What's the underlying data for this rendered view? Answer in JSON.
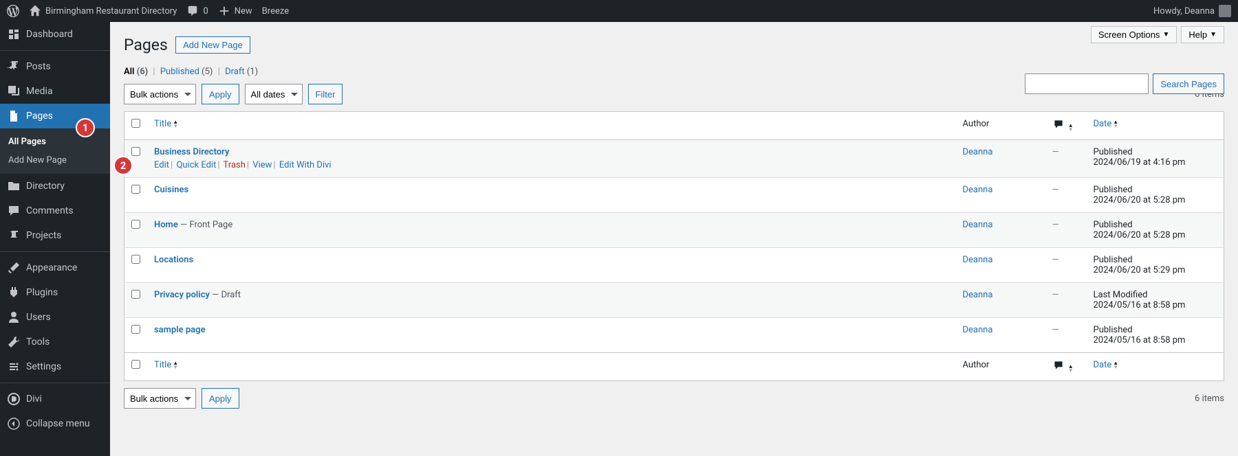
{
  "toolbar": {
    "site_name": "Birmingham Restaurant Directory",
    "comment_count": "0",
    "new_label": "New",
    "breeze_label": "Breeze",
    "howdy": "Howdy, Deanna"
  },
  "sidebar": {
    "items": [
      {
        "label": "Dashboard"
      },
      {
        "label": "Posts"
      },
      {
        "label": "Media"
      },
      {
        "label": "Pages"
      },
      {
        "label": "Directory"
      },
      {
        "label": "Comments"
      },
      {
        "label": "Projects"
      },
      {
        "label": "Appearance"
      },
      {
        "label": "Plugins"
      },
      {
        "label": "Users"
      },
      {
        "label": "Tools"
      },
      {
        "label": "Settings"
      },
      {
        "label": "Divi"
      },
      {
        "label": "Collapse menu"
      }
    ],
    "sub": {
      "all_pages": "All Pages",
      "add_new": "Add New Page"
    }
  },
  "header": {
    "title": "Pages",
    "add_new": "Add New Page",
    "screen_options": "Screen Options",
    "help": "Help"
  },
  "filters": {
    "all": "All",
    "all_count": "(6)",
    "published": "Published",
    "published_count": "(5)",
    "draft": "Draft",
    "draft_count": "(1)",
    "bulk_actions": "Bulk actions",
    "apply": "Apply",
    "all_dates": "All dates",
    "filter": "Filter",
    "items_count": "6 items",
    "search_btn": "Search Pages"
  },
  "table": {
    "th_title": "Title",
    "th_author": "Author",
    "th_date": "Date",
    "row_actions": {
      "edit": "Edit",
      "quick_edit": "Quick Edit",
      "trash": "Trash",
      "view": "View",
      "edit_divi": "Edit With Divi"
    },
    "front_page_tag": " — Front Page",
    "draft_tag": " — Draft",
    "rows": [
      {
        "title": "Business Directory",
        "author": "Deanna",
        "status": "Published",
        "date": "2024/06/19 at 4:16 pm",
        "show_actions": true
      },
      {
        "title": "Cuisines",
        "author": "Deanna",
        "status": "Published",
        "date": "2024/06/20 at 5:28 pm"
      },
      {
        "title": "Home",
        "author": "Deanna",
        "status": "Published",
        "date": "2024/06/20 at 5:28 pm",
        "front_page": true
      },
      {
        "title": "Locations",
        "author": "Deanna",
        "status": "Published",
        "date": "2024/06/20 at 5:29 pm"
      },
      {
        "title": "Privacy policy",
        "author": "Deanna",
        "status": "Last Modified",
        "date": "2024/05/16 at 8:58 pm",
        "draft": true
      },
      {
        "title": "sample page",
        "author": "Deanna",
        "status": "Published",
        "date": "2024/05/16 at 8:58 pm"
      }
    ]
  },
  "badges": {
    "b1": "1",
    "b2": "2"
  }
}
